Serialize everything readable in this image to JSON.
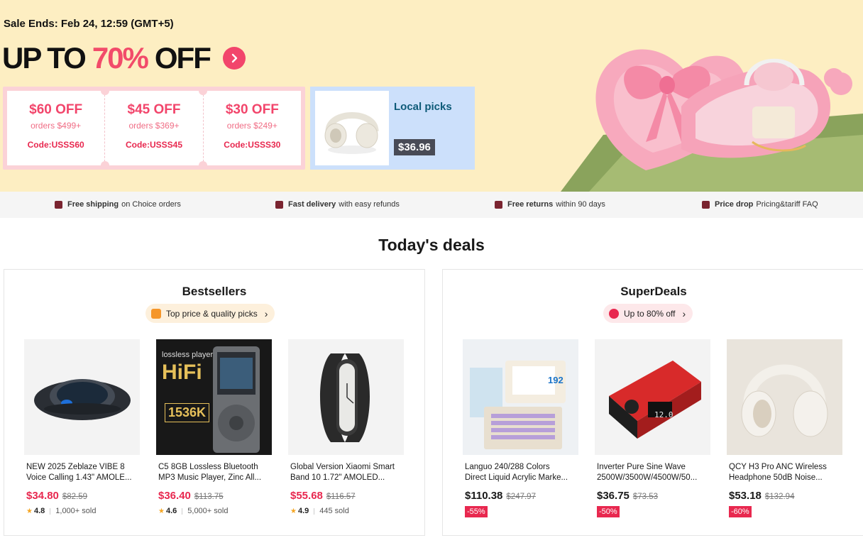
{
  "banner": {
    "sale_ends": "Sale Ends: Feb 24, 12:59 (GMT+5)",
    "headline_pre": "UP TO",
    "headline_pct": "70%",
    "headline_post": "OFF",
    "coupons": [
      {
        "amount": "$60 OFF",
        "min": "orders $499+",
        "code": "Code:USSS60"
      },
      {
        "amount": "$45 OFF",
        "min": "orders $369+",
        "code": "Code:USSS45"
      },
      {
        "amount": "$30 OFF",
        "min": "orders $249+",
        "code": "Code:USSS30"
      }
    ],
    "local": {
      "title": "Local picks",
      "price": "$36.96"
    }
  },
  "benefits": [
    {
      "bold": "Free shipping",
      "rest": "on Choice orders",
      "icon": "truck-icon"
    },
    {
      "bold": "Fast delivery",
      "rest": "with easy refunds",
      "icon": "box-icon"
    },
    {
      "bold": "Free returns",
      "rest": "within 90 days",
      "icon": "return-icon"
    },
    {
      "bold": "Price drop",
      "rest": "Pricing&tariff FAQ",
      "icon": "tag-icon"
    }
  ],
  "deals_title": "Today's deals",
  "bestsellers": {
    "title": "Bestsellers",
    "pill": "Top price & quality picks",
    "products": [
      {
        "line1": "NEW 2025 Zeblaze VIBE 8",
        "line2": "Voice Calling 1.43\" AMOLE...",
        "price": "$34.80",
        "was": "$82.59",
        "rating": "4.8",
        "sold": "1,000+ sold"
      },
      {
        "line1": "C5 8GB Lossless Bluetooth",
        "line2": "MP3 Music Player, Zinc All...",
        "price": "$36.40",
        "was": "$113.75",
        "rating": "4.6",
        "sold": "5,000+ sold",
        "img_text1": "lossless player",
        "img_text2": "HiFi",
        "img_text3": "1536K"
      },
      {
        "line1": "Global Version Xiaomi Smart",
        "line2": "Band 10 1.72\" AMOLED...",
        "price": "$55.68",
        "was": "$116.57",
        "rating": "4.9",
        "sold": "445 sold"
      }
    ]
  },
  "superdeals": {
    "title": "SuperDeals",
    "pill": "Up to 80% off",
    "products": [
      {
        "line1": "Languo 240/288 Colors",
        "line2": "Direct Liquid Acrylic Marke...",
        "price": "$110.38",
        "was": "$247.97",
        "discount": "-55%",
        "img_text": "192"
      },
      {
        "line1": "Inverter Pure Sine Wave",
        "line2": "2500W/3500W/4500W/50...",
        "price": "$36.75",
        "was": "$73.53",
        "discount": "-50%",
        "img_text": "12.0"
      },
      {
        "line1": "QCY H3 Pro ANC Wireless",
        "line2": "Headphone 50dB Noise...",
        "price": "$53.18",
        "was": "$132.94",
        "discount": "-60%"
      }
    ]
  },
  "colors": {
    "accent": "#f2456b",
    "price_red": "#e8284f",
    "banner_bg": "#fdeec2"
  }
}
